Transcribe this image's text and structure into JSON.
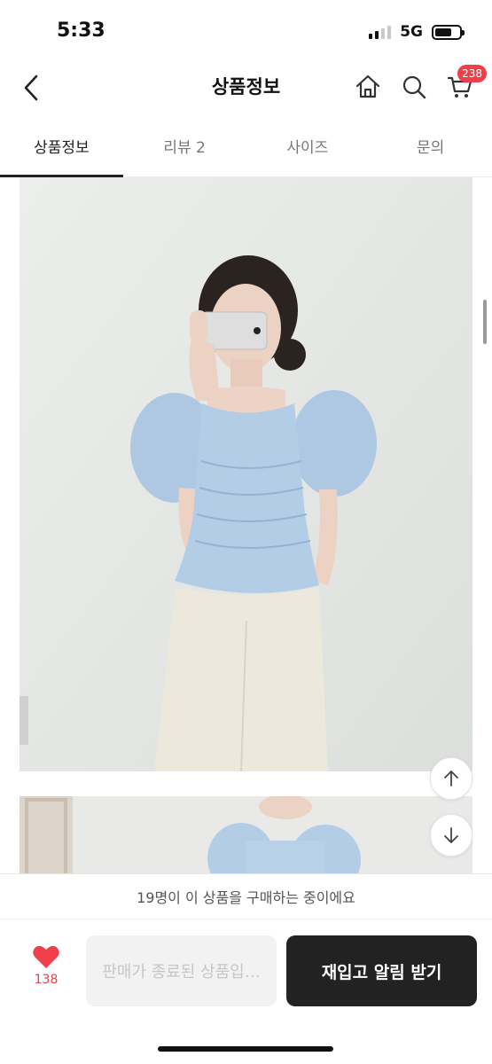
{
  "status_bar": {
    "time": "5:33",
    "network": "5G"
  },
  "header": {
    "title": "상품정보",
    "back_icon": "chevron-left-icon",
    "home_icon": "home-icon",
    "search_icon": "search-icon",
    "cart_icon": "cart-icon",
    "cart_badge": "238"
  },
  "tabs": [
    {
      "label": "상품정보",
      "active": true
    },
    {
      "label": "리뷰 2",
      "active": false
    },
    {
      "label": "사이즈",
      "active": false
    },
    {
      "label": "문의",
      "active": false
    }
  ],
  "floating": {
    "up_icon": "arrow-up-icon",
    "down_icon": "arrow-down-icon"
  },
  "banner": {
    "text": "19명이 이 상품을 구매하는 중이에요"
  },
  "bottom_bar": {
    "wish_icon": "heart-icon",
    "wish_count": "138",
    "disabled_label": "판매가 종료된 상품입…",
    "restock_label": "재입고 알림 받기"
  },
  "colors": {
    "accent": "#ef3f4a",
    "dark_button": "#222222",
    "blouse": "#b4cde6",
    "pants": "#ede8dc",
    "wall": "#e4e6e3"
  }
}
